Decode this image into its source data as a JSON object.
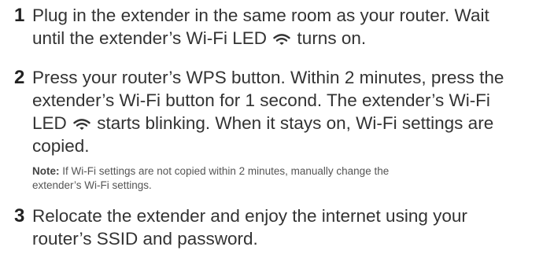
{
  "steps": [
    {
      "number": "1",
      "lines": [
        "Plug in the extender in the same room as your router. Wait",
        "until the extender’s Wi-Fi LED",
        "turns on."
      ]
    },
    {
      "number": "2",
      "lines": [
        "Press your router’s WPS button. Within 2 minutes, press the",
        "extender’s Wi-Fi button for 1 second. The extender’s Wi-Fi",
        "LED",
        "starts blinking. When it stays on, Wi-Fi settings are",
        "copied."
      ],
      "note": {
        "label": "Note:",
        "line1": "If Wi-Fi settings are not copied within 2 minutes, manually change the",
        "line2": "extender’s Wi-Fi settings."
      }
    },
    {
      "number": "3",
      "lines": [
        "Relocate the extender and enjoy the internet using your",
        "router’s SSID and password."
      ]
    }
  ],
  "icons": {
    "wifi_led": "wifi-icon"
  }
}
